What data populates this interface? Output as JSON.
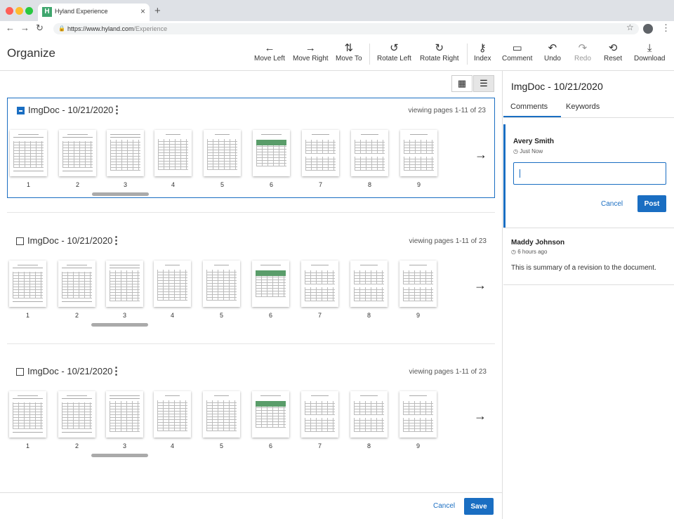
{
  "browser": {
    "tab_title": "Hyland Experience",
    "tab_favicon": "H",
    "url_host": "https://www.hyland.com",
    "url_path": "/Experience",
    "traffic_lights": [
      "#ff5f57",
      "#febc2e",
      "#28c840"
    ]
  },
  "app": {
    "title": "Organize",
    "accent": "#1a6ec2"
  },
  "toolbar": {
    "move_left": "Move Left",
    "move_right": "Move Right",
    "move_to": "Move To",
    "rotate_left": "Rotate Left",
    "rotate_right": "Rotate Right",
    "index": "Index",
    "comment": "Comment",
    "undo": "Undo",
    "redo": "Redo",
    "reset": "Reset",
    "download": "Download"
  },
  "documents": [
    {
      "title": "ImgDoc - 10/21/2020",
      "viewing": "viewing pages  1-11 of 23",
      "selected": true
    },
    {
      "title": "ImgDoc - 10/21/2020",
      "viewing": "viewing pages  1-11 of 23",
      "selected": false
    },
    {
      "title": "ImgDoc - 10/21/2020",
      "viewing": "viewing pages  1-11 of 23",
      "selected": false
    }
  ],
  "page_numbers": [
    "1",
    "2",
    "3",
    "4",
    "5",
    "6",
    "7",
    "8",
    "9"
  ],
  "footer": {
    "cancel": "Cancel",
    "save": "Save"
  },
  "panel": {
    "title": "ImgDoc - 10/21/2020",
    "tabs": [
      "Comments",
      "Keywords"
    ],
    "new_comment": {
      "author": "Avery Smith",
      "time": "Just Now",
      "cancel": "Cancel",
      "post": "Post"
    },
    "comments": [
      {
        "author": "Maddy Johnson",
        "time": "6 hours ago",
        "text": "This is summary of a revision to the document."
      }
    ]
  }
}
